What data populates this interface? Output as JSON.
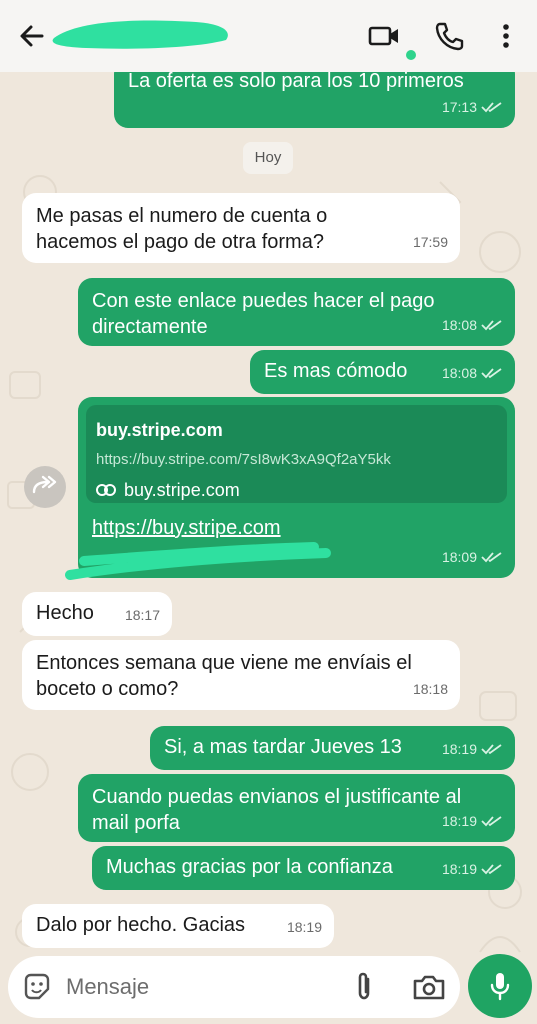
{
  "header": {
    "icons": [
      "back-arrow-icon",
      "video-call-icon",
      "voice-call-icon",
      "more-options-icon"
    ]
  },
  "chat": {
    "day_chip": "Hoy",
    "messages": [
      {
        "dir": "out",
        "text": "La oferta es solo para los 10 primeros",
        "time": "17:13",
        "read": true
      },
      {
        "dir": "in",
        "text": "Me pasas el numero de cuenta o\nhacemos el pago de otra forma?",
        "time": "17:59"
      },
      {
        "dir": "out",
        "text": "Con este enlace puedes hacer el pago\ndirectamente",
        "time": "18:08",
        "read": true
      },
      {
        "dir": "out",
        "text": "Es mas cómodo",
        "time": "18:08",
        "read": true
      },
      {
        "dir": "out",
        "type": "link",
        "preview_title": "buy.stripe.com",
        "preview_url": "https://buy.stripe.com/7sI8wK3xA9Qf2aY5kk",
        "preview_domain": "buy.stripe.com",
        "link_text": "https://buy.stripe.com",
        "time": "18:09",
        "read": true
      },
      {
        "dir": "in",
        "text": "Hecho",
        "time": "18:17"
      },
      {
        "dir": "in",
        "text": "Entonces semana que viene me envíais el\nboceto o como?",
        "time": "18:18"
      },
      {
        "dir": "out",
        "text": "Si, a mas tardar Jueves 13",
        "time": "18:19",
        "read": true
      },
      {
        "dir": "out",
        "text": "Cuando puedas envianos el justificante al\nmail porfa",
        "time": "18:19",
        "read": true
      },
      {
        "dir": "out",
        "text": "Muchas gracias por la confianza",
        "time": "18:19",
        "read": true
      },
      {
        "dir": "in",
        "text": "Dalo por hecho. Gacias",
        "time": "18:19"
      }
    ]
  },
  "composer": {
    "placeholder": "Mensaje",
    "icons": [
      "emoji-sticker-icon",
      "attach-icon",
      "camera-icon",
      "microphone-icon"
    ]
  },
  "colors": {
    "outgoing": "#21a366",
    "incoming": "#ffffff",
    "header": "#f6f5f3",
    "accent": "#1fa463"
  }
}
